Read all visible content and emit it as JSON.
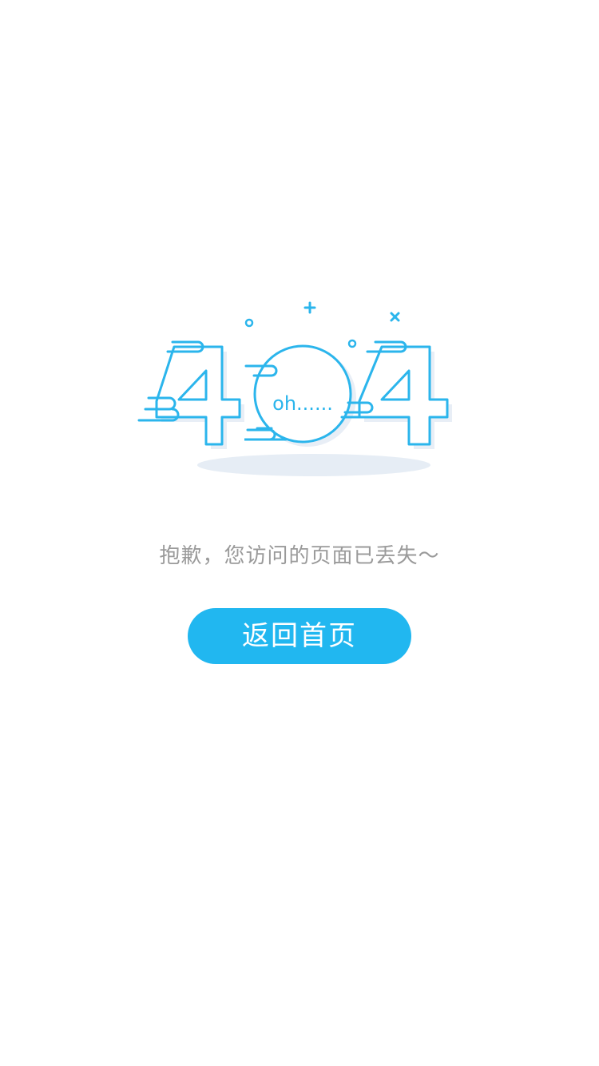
{
  "illustration": {
    "code": "404",
    "bubble_text": "oh......",
    "icon": "404-error-illustration"
  },
  "message": "抱歉，您访问的页面已丢失～",
  "button": {
    "label": "返回首页"
  },
  "colors": {
    "accent": "#21b7f0",
    "stroke": "#2bb5ec",
    "shadow": "#e7eef6",
    "message_text": "#9a9a9a",
    "background": "#ffffff"
  }
}
